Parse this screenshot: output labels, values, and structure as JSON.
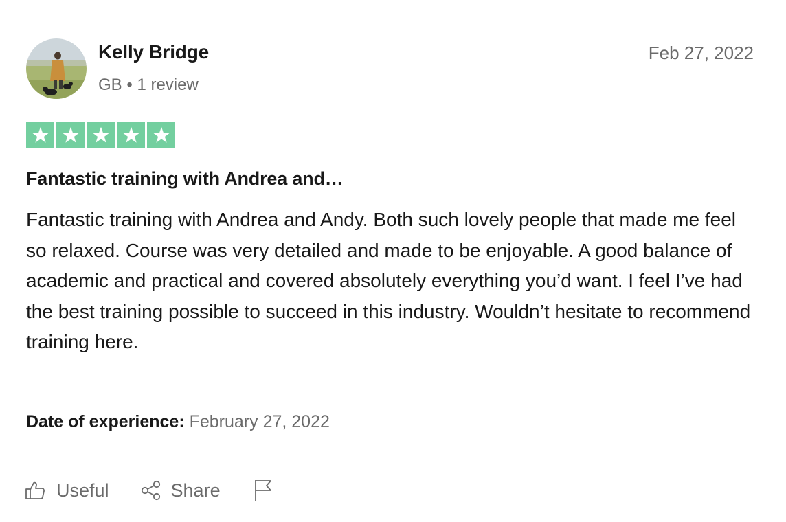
{
  "reviewer": {
    "name": "Kelly Bridge",
    "country": "GB",
    "separator": "•",
    "review_count": "1 review"
  },
  "review": {
    "date": "Feb 27, 2022",
    "rating": 5,
    "title": "Fantastic training with Andrea and…",
    "body": "Fantastic training with Andrea and Andy. Both such lovely people that made me feel so relaxed. Course was very detailed and made to be enjoyable. A good balance of academic and practical and covered absolutely everything you’d want. I feel I’ve had the best training possible to succeed in this industry. Wouldn’t hesitate to recommend training here."
  },
  "experience": {
    "label": "Date of experience:",
    "value": "February 27, 2022"
  },
  "actions": {
    "useful_label": "Useful",
    "useful_icon": "thumbs-up-icon",
    "share_label": "Share",
    "share_icon": "share-icon",
    "report_icon": "flag-icon"
  },
  "colors": {
    "star_green": "#73cf9f",
    "text_primary": "#191919",
    "text_secondary": "#6b6b6b"
  }
}
